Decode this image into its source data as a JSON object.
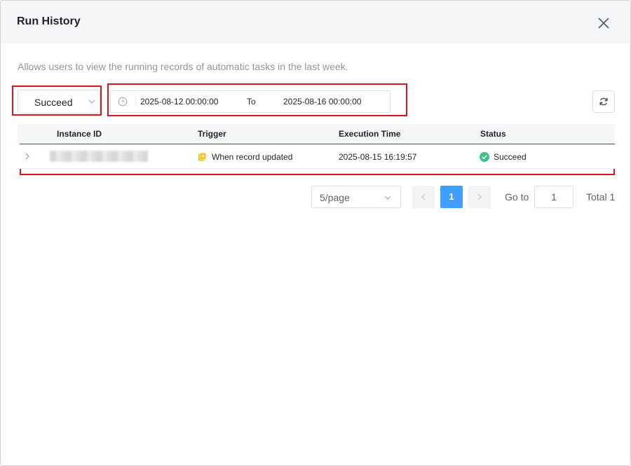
{
  "dialog": {
    "title": "Run History",
    "description": "Allows users to view the running records of automatic tasks in the last week."
  },
  "filters": {
    "status_value": "Succeed",
    "date_start": "2025-08-12 00:00:00",
    "date_separator": "To",
    "date_end": "2025-08-16 00:00:00"
  },
  "table": {
    "columns": [
      "Instance ID",
      "Trigger",
      "Execution Time",
      "Status"
    ],
    "rows": [
      {
        "instance_id": "",
        "trigger": "When record updated",
        "execution_time": "2025-08-15 16:19:57",
        "status": "Succeed"
      }
    ]
  },
  "pagination": {
    "page_size": "5/page",
    "current_page": "1",
    "goto_label": "Go to",
    "goto_value": "1",
    "total": "Total 1"
  },
  "colors": {
    "accent": "#409eff",
    "success": "#3ec287",
    "trigger": "#f0b90b",
    "annotation": "#e0141e"
  },
  "icons": {
    "close": "close-icon",
    "chevron": "chevron-down-icon",
    "clock": "clock-icon",
    "refresh": "refresh-icon",
    "expand": "chevron-right-icon",
    "trigger": "record-update-icon",
    "status": "check-circle-icon"
  }
}
